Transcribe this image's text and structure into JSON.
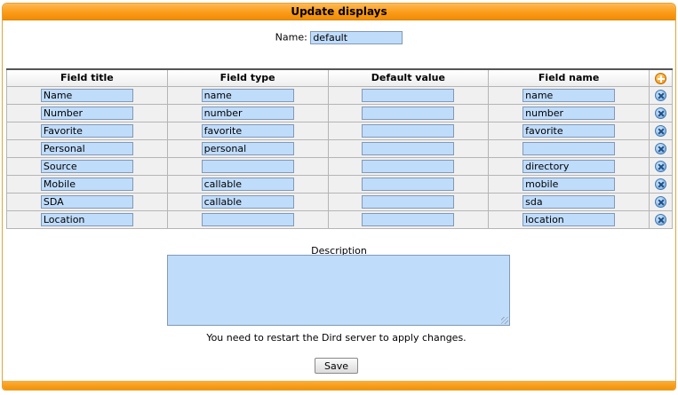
{
  "title": "Update displays",
  "name_label": "Name:",
  "name_value": "default",
  "table": {
    "headers": [
      "Field title",
      "Field type",
      "Default value",
      "Field name"
    ],
    "rows": [
      {
        "title": "Name",
        "type": "name",
        "default": "",
        "field": "name"
      },
      {
        "title": "Number",
        "type": "number",
        "default": "",
        "field": "number"
      },
      {
        "title": "Favorite",
        "type": "favorite",
        "default": "",
        "field": "favorite"
      },
      {
        "title": "Personal",
        "type": "personal",
        "default": "",
        "field": ""
      },
      {
        "title": "Source",
        "type": "",
        "default": "",
        "field": "directory"
      },
      {
        "title": "Mobile",
        "type": "callable",
        "default": "",
        "field": "mobile"
      },
      {
        "title": "SDA",
        "type": "callable",
        "default": "",
        "field": "sda"
      },
      {
        "title": "Location",
        "type": "",
        "default": "",
        "field": "location"
      }
    ]
  },
  "icons": {
    "add": "add-icon",
    "delete": "delete-icon"
  },
  "description_label": "Description",
  "description_value": "",
  "restart_message": "You need to restart the Dird server to apply changes.",
  "save_label": "Save",
  "colors": {
    "accent": "#f7a21b",
    "input_bg": "#bfdcfb"
  }
}
